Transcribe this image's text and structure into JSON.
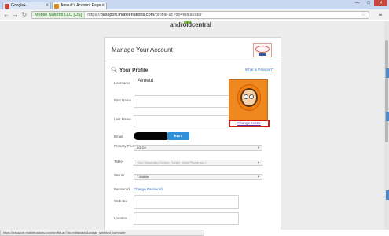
{
  "browser": {
    "tabs": [
      {
        "title": "Google+",
        "favicon_color": "#d23f31"
      },
      {
        "title": "Ameult's Account Page -",
        "favicon_color": "#e08a1a"
      }
    ],
    "window_controls": {
      "minimize": "—",
      "maximize": "□",
      "close": "✕"
    },
    "address": {
      "ev_label": "Mobile Nations LLC [US]",
      "protocol": "https://",
      "host": "passport.mobilenations.com",
      "path": "/profile-ac?do=editavatar"
    },
    "status_url": "https://passport.mobilenations.com/profile-ac?do=editavatar&avatar_selected_computer"
  },
  "site": {
    "logo_text": "androidcentral"
  },
  "card": {
    "title": "Manage Your Account",
    "profile_heading": "Your Profile",
    "what_is_passport": "What is Passport?",
    "username_label": "Username",
    "username_value": "Almeut",
    "first_name_label": "First Name",
    "last_name_label": "Last Name",
    "email_label": "Email",
    "edit_button": "EDIT",
    "primary_phone_label": "Primary Phone",
    "primary_phone_value": "LG G4",
    "tablet_label": "Tablet",
    "tablet_placeholder": "Your Secondary Device (Tablet, Work Phone etc.)",
    "carrier_label": "Carrier",
    "carrier_value": "T-Mobile",
    "password_label": "Password",
    "change_password": "Change Password",
    "web_bio_label": "Web Bio",
    "location_label": "Location",
    "change_avatar": "Change Avatar"
  }
}
